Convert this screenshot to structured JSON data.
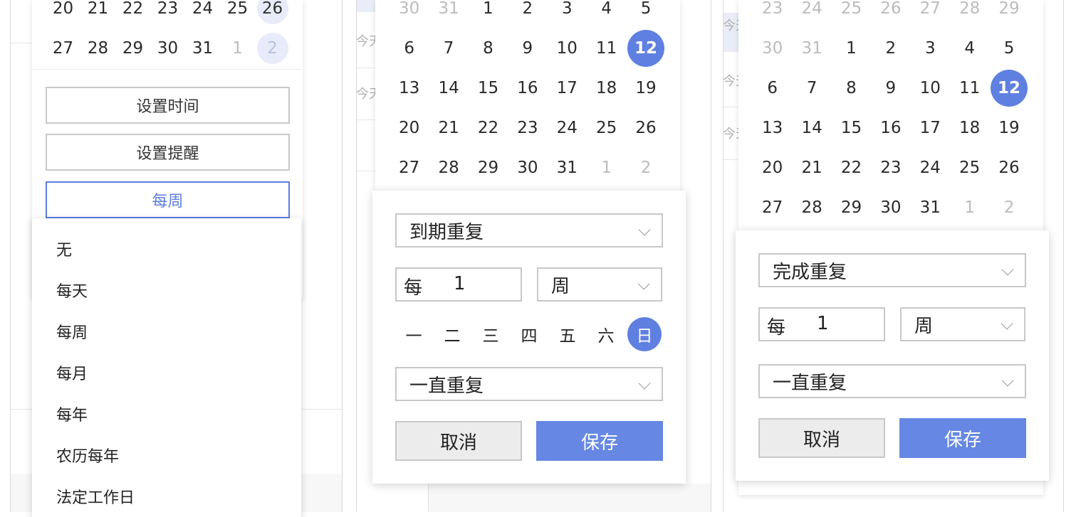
{
  "colors": {
    "accent": "#5f80e0",
    "save_button": "#6687e3",
    "border": "#c8c8c8"
  },
  "background": {
    "peek_text": "今天",
    "list_marker": "/"
  },
  "panel1": {
    "calendar": {
      "rows": [
        [
          {
            "d": "20"
          },
          {
            "d": "21"
          },
          {
            "d": "22"
          },
          {
            "d": "23"
          },
          {
            "d": "24"
          },
          {
            "d": "25"
          },
          {
            "d": "26",
            "soft": true
          }
        ],
        [
          {
            "d": "27"
          },
          {
            "d": "28"
          },
          {
            "d": "29"
          },
          {
            "d": "30"
          },
          {
            "d": "31"
          },
          {
            "d": "1",
            "muted": true
          },
          {
            "d": "2",
            "muted": true,
            "soft": true
          }
        ]
      ]
    },
    "buttons": {
      "set_time": "设置时间",
      "set_reminder": "设置提醒",
      "repeat": "每周"
    },
    "repeat_menu": [
      "无",
      "每天",
      "每周",
      "每月",
      "每年",
      "农历每年",
      "法定工作日"
    ]
  },
  "panel2": {
    "calendar": {
      "rows": [
        [
          {
            "d": "30",
            "muted": true
          },
          {
            "d": "31",
            "muted": true
          },
          {
            "d": "1"
          },
          {
            "d": "2"
          },
          {
            "d": "3"
          },
          {
            "d": "4"
          },
          {
            "d": "5"
          }
        ],
        [
          {
            "d": "6"
          },
          {
            "d": "7"
          },
          {
            "d": "8"
          },
          {
            "d": "9"
          },
          {
            "d": "10"
          },
          {
            "d": "11"
          },
          {
            "d": "12",
            "sel": true
          }
        ],
        [
          {
            "d": "13"
          },
          {
            "d": "14"
          },
          {
            "d": "15"
          },
          {
            "d": "16"
          },
          {
            "d": "17"
          },
          {
            "d": "18"
          },
          {
            "d": "19"
          }
        ],
        [
          {
            "d": "20"
          },
          {
            "d": "21"
          },
          {
            "d": "22"
          },
          {
            "d": "23"
          },
          {
            "d": "24"
          },
          {
            "d": "25"
          },
          {
            "d": "26"
          }
        ],
        [
          {
            "d": "27"
          },
          {
            "d": "28"
          },
          {
            "d": "29"
          },
          {
            "d": "30"
          },
          {
            "d": "31"
          },
          {
            "d": "1",
            "muted": true
          },
          {
            "d": "2",
            "muted": true
          }
        ]
      ]
    },
    "repeat_type": "到期重复",
    "every_label": "每",
    "every_value": "1",
    "unit": "周",
    "weekdays": [
      "一",
      "二",
      "三",
      "四",
      "五",
      "六",
      "日"
    ],
    "selected_weekday": "日",
    "end_rule": "一直重复",
    "cancel": "取消",
    "save": "保存"
  },
  "panel3": {
    "calendar": {
      "rows": [
        [
          {
            "d": "23",
            "muted": true
          },
          {
            "d": "24",
            "muted": true
          },
          {
            "d": "25",
            "muted": true
          },
          {
            "d": "26",
            "muted": true
          },
          {
            "d": "27",
            "muted": true
          },
          {
            "d": "28",
            "muted": true
          },
          {
            "d": "29",
            "muted": true
          }
        ],
        [
          {
            "d": "30",
            "muted": true
          },
          {
            "d": "31",
            "muted": true
          },
          {
            "d": "1"
          },
          {
            "d": "2"
          },
          {
            "d": "3"
          },
          {
            "d": "4"
          },
          {
            "d": "5"
          }
        ],
        [
          {
            "d": "6"
          },
          {
            "d": "7"
          },
          {
            "d": "8"
          },
          {
            "d": "9"
          },
          {
            "d": "10"
          },
          {
            "d": "11"
          },
          {
            "d": "12",
            "sel": true
          }
        ],
        [
          {
            "d": "13"
          },
          {
            "d": "14"
          },
          {
            "d": "15"
          },
          {
            "d": "16"
          },
          {
            "d": "17"
          },
          {
            "d": "18"
          },
          {
            "d": "19"
          }
        ],
        [
          {
            "d": "20"
          },
          {
            "d": "21"
          },
          {
            "d": "22"
          },
          {
            "d": "23"
          },
          {
            "d": "24"
          },
          {
            "d": "25"
          },
          {
            "d": "26"
          }
        ],
        [
          {
            "d": "27"
          },
          {
            "d": "28"
          },
          {
            "d": "29"
          },
          {
            "d": "30"
          },
          {
            "d": "31"
          },
          {
            "d": "1",
            "muted": true
          },
          {
            "d": "2",
            "muted": true
          }
        ]
      ]
    },
    "repeat_type": "完成重复",
    "every_label": "每",
    "every_value": "1",
    "unit": "周",
    "end_rule": "一直重复",
    "cancel": "取消",
    "save": "保存"
  }
}
